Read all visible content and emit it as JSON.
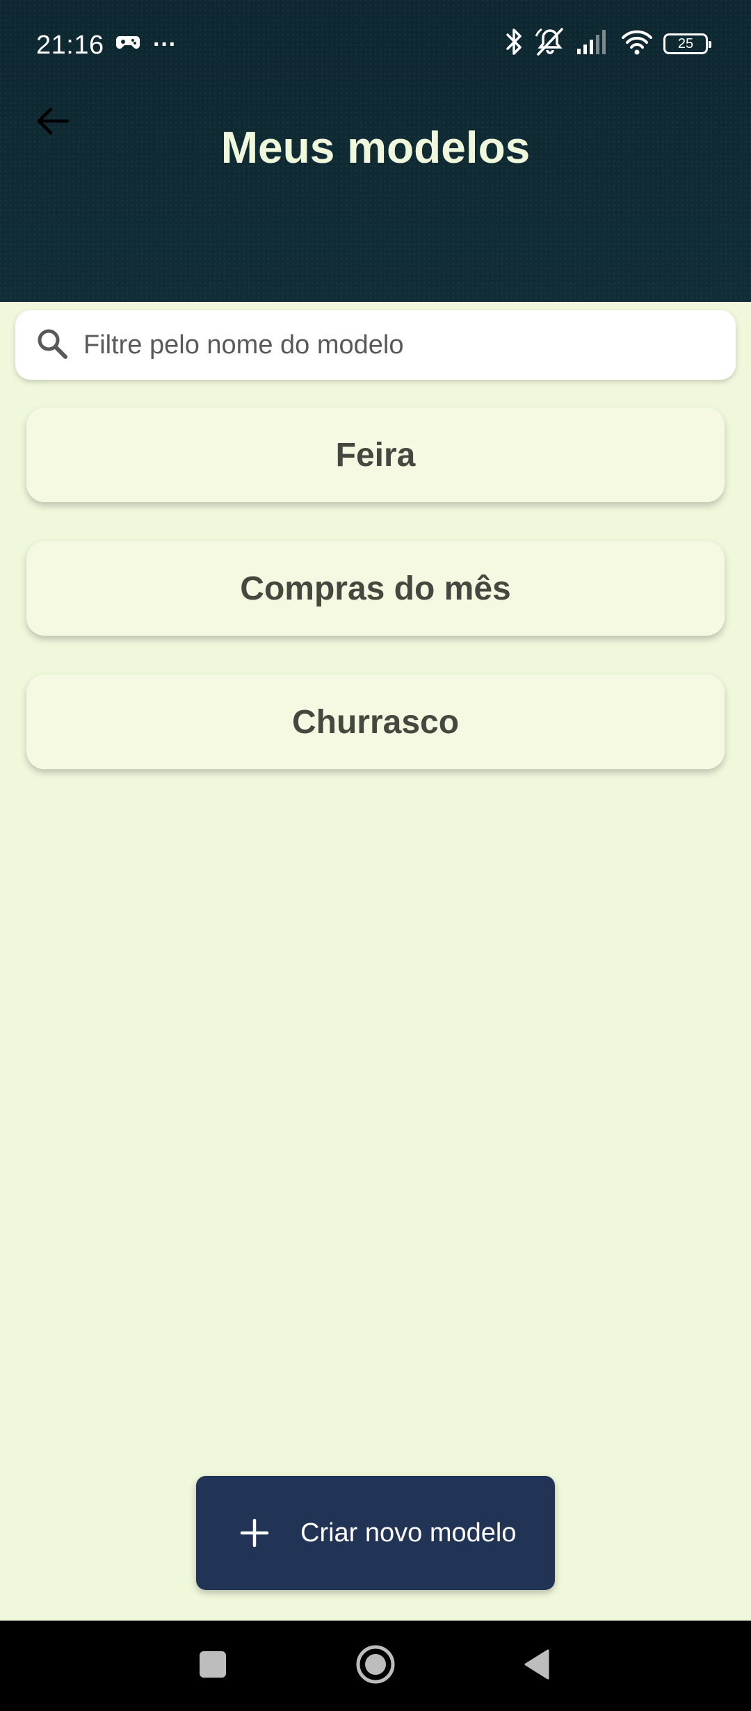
{
  "status_bar": {
    "time": "21:16",
    "overflow_dots": "···",
    "battery_level": "25",
    "icons": [
      "game-controller-icon",
      "bluetooth-icon",
      "mute-icon",
      "signal-icon",
      "wifi-icon",
      "battery-icon"
    ]
  },
  "header": {
    "title": "Meus modelos",
    "back_icon": "arrow-back-icon"
  },
  "search": {
    "placeholder": "Filtre pelo nome do modelo",
    "value": "",
    "icon": "search-icon"
  },
  "models": [
    {
      "label": "Feira"
    },
    {
      "label": "Compras do mês"
    },
    {
      "label": "Churrasco"
    }
  ],
  "fab": {
    "label": "Criar novo modelo",
    "icon": "plus-icon"
  },
  "nav_bar": {
    "buttons": [
      "recents-square-icon",
      "home-circle-icon",
      "back-triangle-icon"
    ]
  },
  "colors": {
    "header_bg": "#0f2a34",
    "title": "#f0f8dc",
    "page_bg": "#f0f8dc",
    "card_bg": "#f5f9e2",
    "card_text": "#45483e",
    "fab_bg": "#223455"
  }
}
